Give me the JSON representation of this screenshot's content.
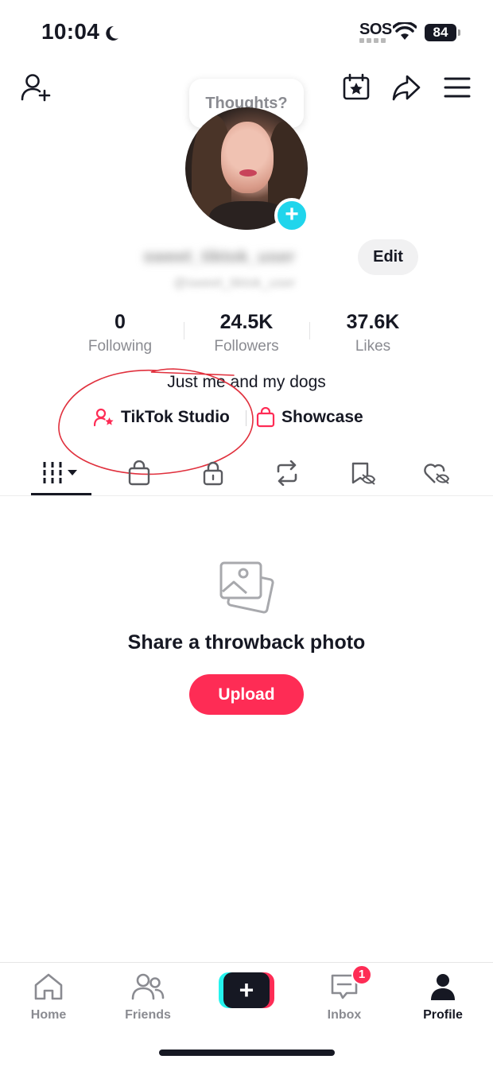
{
  "status_bar": {
    "time": "10:04",
    "carrier": "SOS",
    "battery": "84"
  },
  "header": {
    "thought_prompt": "Thoughts?"
  },
  "profile": {
    "username": "sweet_tiktok_user",
    "handle": "@sweet_tiktok_user",
    "edit_label": "Edit",
    "bio": "Just me and my dogs"
  },
  "stats": [
    {
      "value": "0",
      "label": "Following"
    },
    {
      "value": "24.5K",
      "label": "Followers"
    },
    {
      "value": "37.6K",
      "label": "Likes"
    }
  ],
  "links": {
    "studio": "TikTok Studio",
    "showcase": "Showcase"
  },
  "tabs": [
    "videos-icon",
    "shop-icon",
    "lock-icon",
    "repost-icon",
    "favorites-icon",
    "liked-icon"
  ],
  "empty_state": {
    "title": "Share a throwback photo",
    "upload_label": "Upload"
  },
  "bottom_nav": {
    "items": [
      {
        "label": "Home",
        "icon": "home-icon"
      },
      {
        "label": "Friends",
        "icon": "friends-icon"
      },
      {
        "label": "Inbox",
        "icon": "inbox-icon",
        "badge": "1"
      },
      {
        "label": "Profile",
        "icon": "profile-icon"
      }
    ]
  },
  "colors": {
    "accent": "#fe2c55",
    "cyan": "#20d5ec",
    "text": "#161823",
    "muted": "#8a8b91"
  }
}
